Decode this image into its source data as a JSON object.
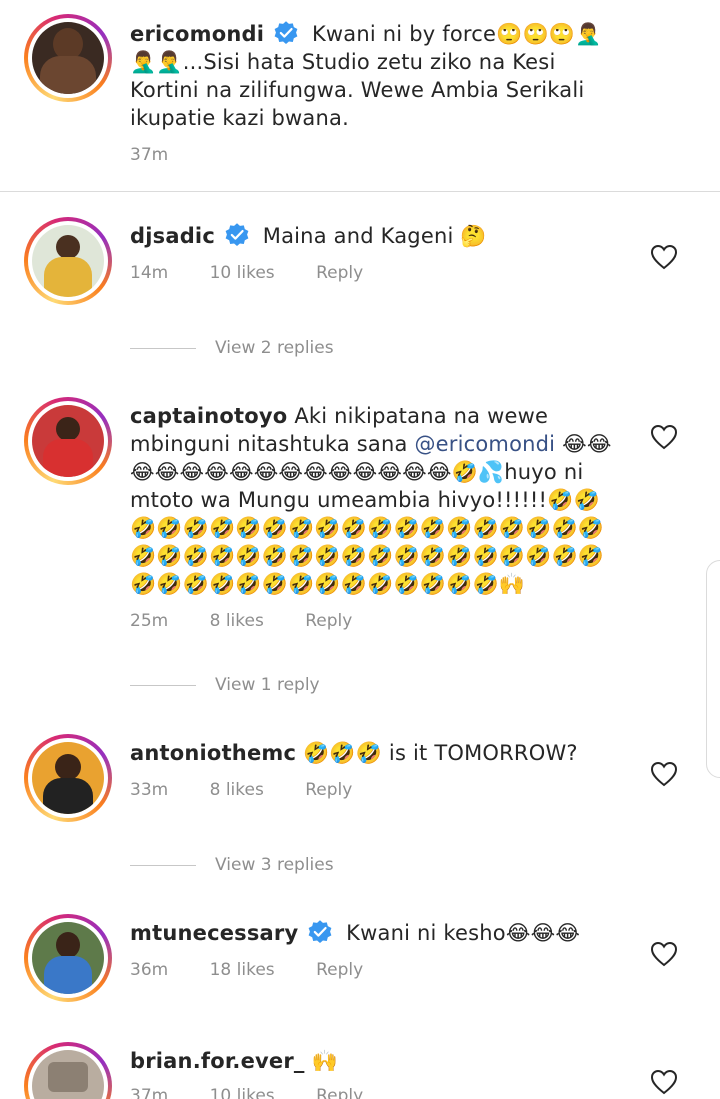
{
  "caption": {
    "username": "ericomondi",
    "text": "Kwani ni by force🙄🙄🙄🤦‍♂️🤦‍♂️🤦‍♂️...Sisi hata Studio zetu ziko na Kesi Kortini na zilifungwa. Wewe Ambia Serikali ikupatie kazi bwana.",
    "time": "37m"
  },
  "comments": [
    {
      "username": "djsadic",
      "verified": true,
      "text": "Maina and Kageni 🤔",
      "time": "14m",
      "likes": "10 likes",
      "reply": "Reply",
      "view_replies": "View 2 replies"
    },
    {
      "username": "captainotoyo",
      "verified": false,
      "text_before_mention": "Aki nikipatana na wewe mbinguni nitashtuka sana ",
      "mention": "@ericomondi",
      "text_after_mention": " 😂😂😂😂😂😂😂😂😂😂😂😂😂😂😂🤣💦huyo ni mtoto wa Mungu umeambia hivyo!!!!!!🤣🤣🤣🤣🤣🤣🤣🤣🤣🤣🤣🤣🤣🤣🤣🤣🤣🤣🤣🤣🤣🤣🤣🤣🤣🤣🤣🤣🤣🤣🤣🤣🤣🤣🤣🤣🤣🤣🤣🤣🤣🤣🤣🤣🤣🤣🤣🤣🤣🤣🤣🤣🙌",
      "time": "25m",
      "likes": "8 likes",
      "reply": "Reply",
      "view_replies": "View 1 reply"
    },
    {
      "username": "antoniothemc",
      "verified": false,
      "text": "🤣🤣🤣 is it TOMORROW?",
      "time": "33m",
      "likes": "8 likes",
      "reply": "Reply",
      "view_replies": "View 3 replies"
    },
    {
      "username": "mtunecessary",
      "verified": true,
      "text": "Kwani ni kesho😂😂😂",
      "time": "36m",
      "likes": "18 likes",
      "reply": "Reply"
    },
    {
      "username": "brian.for.ever_",
      "verified": false,
      "text": "🙌",
      "time": "37m",
      "likes": "10 likes",
      "reply": "Reply"
    }
  ],
  "colors": {
    "verified_blue": "#3897f0",
    "mention_blue": "#385185",
    "meta_gray": "#8e8e8e"
  },
  "icons": {
    "verified": "verified-badge-icon",
    "like": "heart-outline-icon"
  }
}
